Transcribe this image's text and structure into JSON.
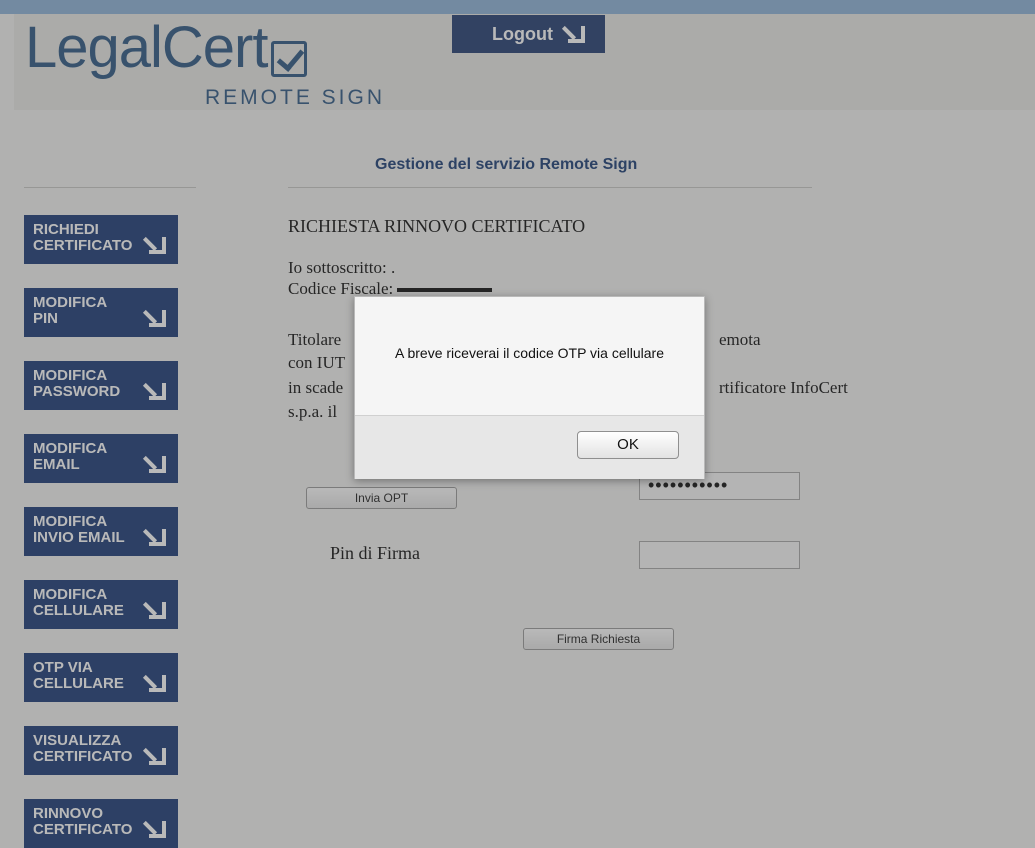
{
  "header": {
    "logo": "LegalCert",
    "logo_subtitle": "REMOTE SIGN",
    "logout_label": "Logout"
  },
  "page": {
    "heading": "Gestione del servizio Remote Sign"
  },
  "sidebar": {
    "items": [
      {
        "line1": "RICHIEDI",
        "line2": "CERTIFICATO"
      },
      {
        "line1": "MODIFICA",
        "line2": "PIN"
      },
      {
        "line1": "MODIFICA",
        "line2": "PASSWORD"
      },
      {
        "line1": "MODIFICA",
        "line2": "EMAIL"
      },
      {
        "line1": "MODIFICA",
        "line2": "INVIO EMAIL"
      },
      {
        "line1": "MODIFICA",
        "line2": "CELLULARE"
      },
      {
        "line1": "OTP VIA",
        "line2": "CELLULARE"
      },
      {
        "line1": "VISUALIZZA",
        "line2": "CERTIFICATO"
      },
      {
        "line1": "RINNOVO",
        "line2": "CERTIFICATO"
      }
    ]
  },
  "form": {
    "title": "RICHIESTA RINNOVO CERTIFICATO",
    "line1": "Io sottoscritto: .",
    "line2": "Codice Fiscale:",
    "line3": "Titolare",
    "line3_end": "emota",
    "line4": "con IUT",
    "line5": "in scade",
    "line5_end": "rtificatore InfoCert",
    "line6": "s.p.a. il",
    "send_otp_label": "Invia OPT",
    "otp_value": "•••••••••••",
    "pin_label": "Pin di Firma",
    "pin_value": "",
    "submit_label": "Firma Richiesta"
  },
  "dialog": {
    "message": "A breve riceverai il codice OTP via cellulare",
    "ok_label": "OK"
  },
  "colors": {
    "nav_button": "#1e3d78",
    "logo_blue": "#2f5a85",
    "heading_blue": "#1d3f77"
  }
}
